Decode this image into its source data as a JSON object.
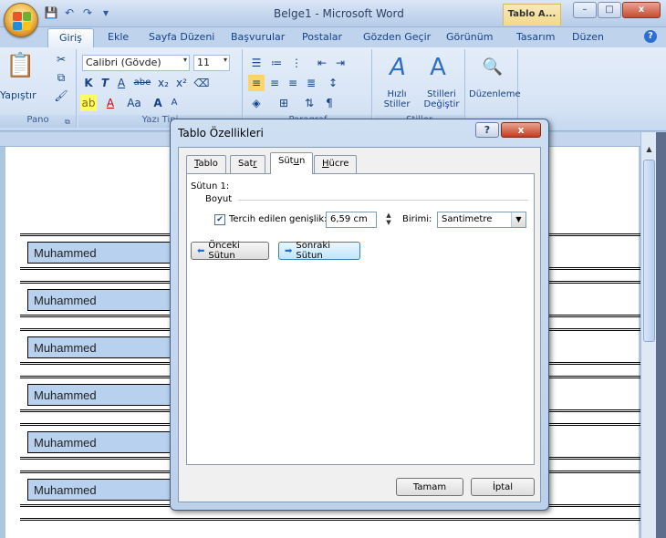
{
  "window": {
    "title": "Belge1 - Microsoft Word",
    "contextual_tab_title": "Tablo A...",
    "controls": {
      "minimize": "–",
      "maximize": "□",
      "close": "x"
    }
  },
  "quick_access": {
    "save": "💾",
    "undo": "↶",
    "redo": "↷",
    "customize": "▾"
  },
  "ribbon_tabs": [
    "Giriş",
    "Ekle",
    "Sayfa Düzeni",
    "Başvurular",
    "Postalar",
    "Gözden Geçir",
    "Görünüm",
    "Tasarım",
    "Düzen"
  ],
  "ribbon": {
    "clipboard": {
      "paste_label": "Yapıştır",
      "group_label": "Pano"
    },
    "font": {
      "font_name": "Calibri (Gövde)",
      "font_size": "11",
      "group_label": "Yazı Tipi",
      "bold": "K",
      "italic": "T",
      "underline": "A",
      "strike": "abe",
      "subscript": "x₂",
      "superscript": "x²",
      "grow": "A",
      "shrink": "A",
      "case": "Aa",
      "clear": "A"
    },
    "paragraph": {
      "group_label": "Paragraf",
      "pilcrow": "¶"
    },
    "styles": {
      "quick_styles": "Hızlı Stiller",
      "change_styles": "Stilleri Değiştir",
      "group_label": "Stiller"
    },
    "editing": {
      "label": "Düzenleme"
    }
  },
  "document": {
    "cells": [
      "Muhammed",
      "Muhammed",
      "Muhammed",
      "Muhammed",
      "Muhammed",
      "Muhammed"
    ]
  },
  "dialog": {
    "title": "Tablo Özellikleri",
    "help": "?",
    "close": "x",
    "tabs": [
      {
        "label": "Tablo",
        "mnemonic": "T"
      },
      {
        "label": "Satır",
        "mnemonic": "r"
      },
      {
        "label": "Sütun",
        "mnemonic": "u"
      },
      {
        "label": "Hücre",
        "mnemonic": "H"
      }
    ],
    "active_tab": "Sütun",
    "column_label": "Sütun 1:",
    "size_label": "Boyut",
    "preferred_width_label": "Tercih edilen genişlik:",
    "preferred_width_checked": true,
    "preferred_width_value": "6,59 cm",
    "unit_label": "Birimi:",
    "unit_value": "Santimetre",
    "prev_button": "Önceki Sütun",
    "next_button": "Sonraki Sütun",
    "ok_button": "Tamam",
    "cancel_button": "İptal"
  }
}
